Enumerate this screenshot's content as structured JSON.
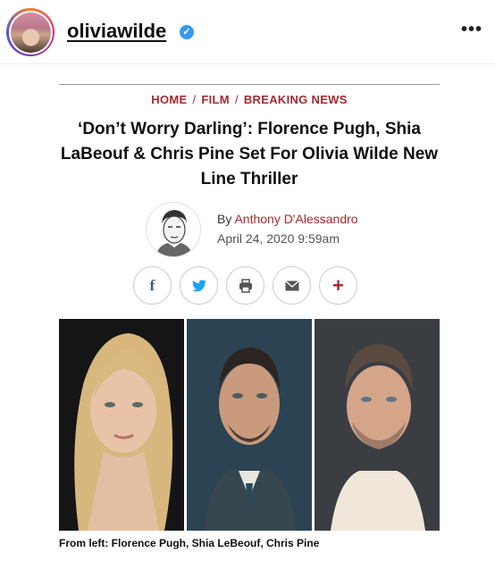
{
  "post": {
    "username": "oliviawilde",
    "verified_mark": "✓",
    "more_label": "•••"
  },
  "icons": {
    "verified": "verified-badge-icon",
    "more": "more-options-icon"
  },
  "article": {
    "breadcrumb": [
      "HOME",
      "FILM",
      "BREAKING NEWS"
    ],
    "breadcrumb_separator": "/",
    "headline": "‘Don’t Worry Darling’: Florence Pugh, Shia LaBeouf & Chris Pine Set For Olivia Wilde New Line Thriller",
    "byline_prefix": "By",
    "author": "Anthony D'Alessandro",
    "date": "April 24, 2020 9:59am",
    "share_buttons": [
      {
        "name": "facebook",
        "glyph": "f"
      },
      {
        "name": "twitter",
        "glyph": "🐦"
      },
      {
        "name": "print",
        "glyph": "⎙"
      },
      {
        "name": "email",
        "glyph": "✉"
      },
      {
        "name": "more",
        "glyph": "+"
      }
    ],
    "caption": "From left: Florence Pugh, Shia LeBeouf, Chris Pine"
  },
  "colors": {
    "accent": "#a8282e",
    "verified": "#3897f0",
    "facebook": "#3b5998",
    "twitter": "#1da1f2"
  }
}
